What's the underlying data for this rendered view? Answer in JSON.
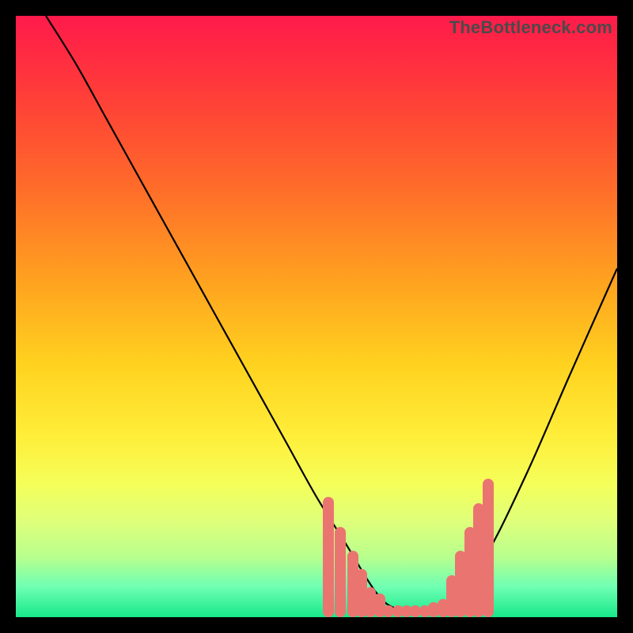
{
  "watermark": "TheBottleneck.com",
  "colors": {
    "bar": "#ea7570",
    "curve": "#000000",
    "gradient_top": "#ff1a4b",
    "gradient_bottom": "#17e88a"
  },
  "chart_data": {
    "type": "line",
    "title": "",
    "xlabel": "",
    "ylabel": "",
    "xlim": [
      0,
      100
    ],
    "ylim": [
      0,
      100
    ],
    "series": [
      {
        "name": "bottleneck-curve",
        "x": [
          5,
          10,
          15,
          20,
          25,
          30,
          35,
          40,
          45,
          50,
          55,
          58,
          60,
          62,
          65,
          68,
          72,
          78,
          85,
          92,
          100
        ],
        "y": [
          100,
          92,
          83,
          74,
          65,
          56,
          47,
          38,
          29,
          20,
          12,
          7,
          4,
          2,
          1,
          1,
          3,
          10,
          24,
          40,
          58
        ]
      }
    ],
    "bars_left": {
      "name": "left-cluster",
      "x": [
        52,
        54,
        56,
        57.5,
        59,
        60.5
      ],
      "h": [
        20,
        15,
        11,
        8,
        5,
        4
      ]
    },
    "bars_center": {
      "name": "valley-cluster",
      "x": [
        62,
        63.5,
        65,
        66.5,
        68,
        69.5,
        71
      ],
      "h": [
        2,
        2,
        2,
        2,
        2,
        2.5,
        3
      ]
    },
    "bars_right": {
      "name": "right-cluster",
      "x": [
        72.5,
        74,
        75.5,
        77,
        78.5
      ],
      "h": [
        7,
        11,
        15,
        19,
        23
      ]
    }
  }
}
